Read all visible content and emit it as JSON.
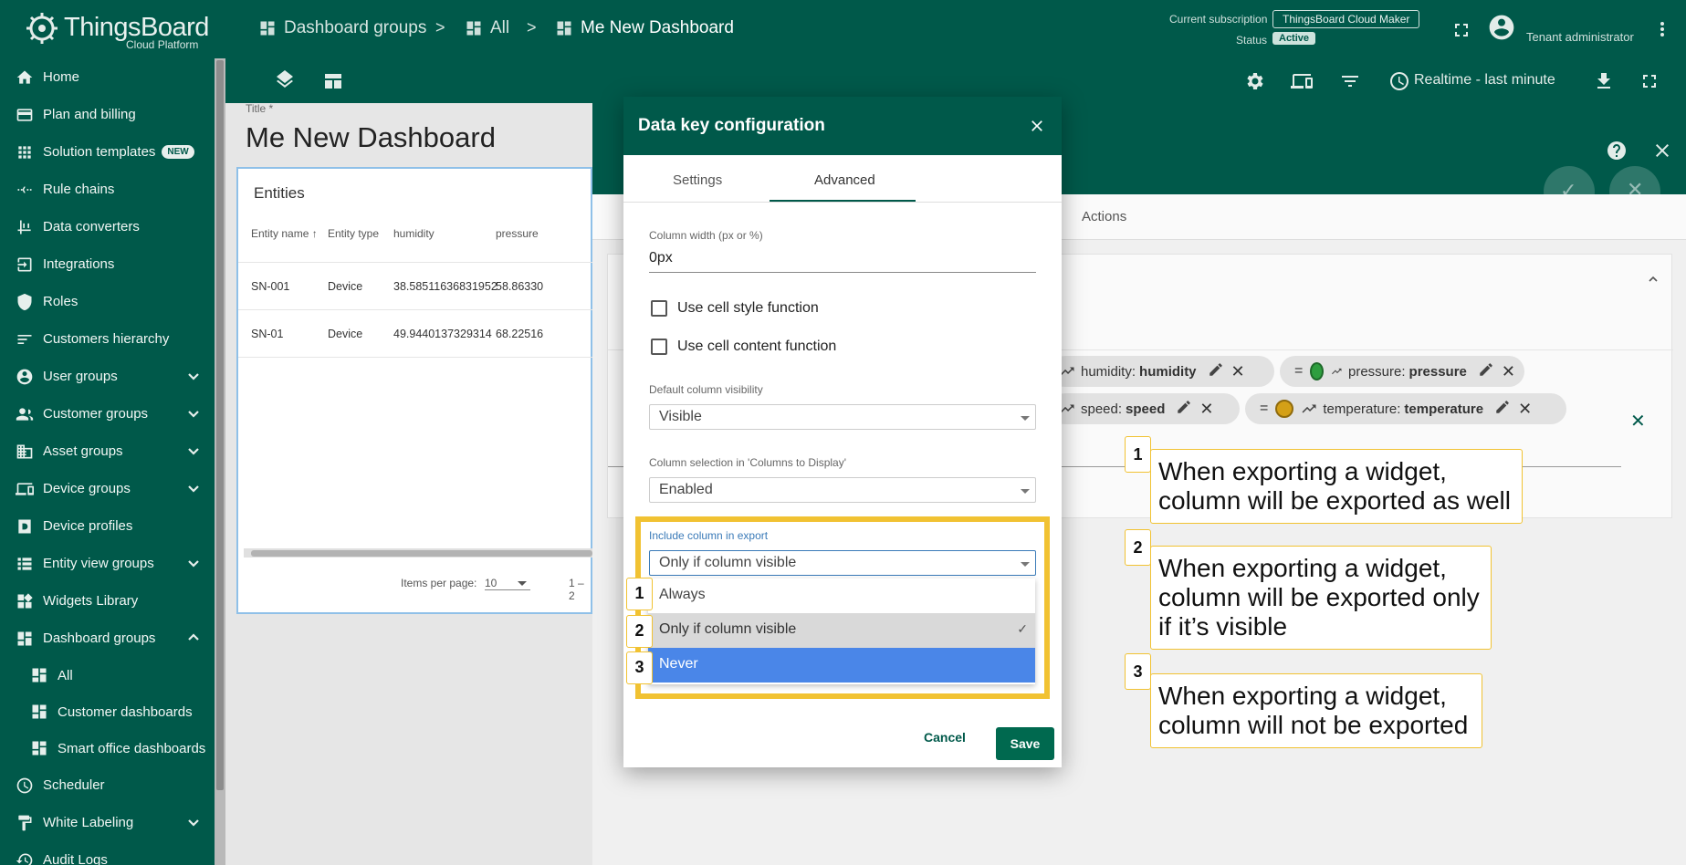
{
  "app": {
    "logo_name": "ThingsBoard",
    "logo_sub": "Cloud Platform"
  },
  "sidebar": {
    "items": [
      {
        "label": "Home",
        "icon": "home-icon"
      },
      {
        "label": "Plan and billing",
        "icon": "billing-icon"
      },
      {
        "label": "Solution templates",
        "icon": "grid-icon",
        "badge": "NEW"
      },
      {
        "label": "Rule chains",
        "icon": "rule-chain-icon"
      },
      {
        "label": "Data converters",
        "icon": "converter-icon"
      },
      {
        "label": "Integrations",
        "icon": "integration-icon"
      },
      {
        "label": "Roles",
        "icon": "shield-icon"
      },
      {
        "label": "Customers hierarchy",
        "icon": "hierarchy-icon"
      },
      {
        "label": "User groups",
        "icon": "user-icon",
        "expandable": true
      },
      {
        "label": "Customer groups",
        "icon": "people-icon",
        "expandable": true
      },
      {
        "label": "Asset groups",
        "icon": "asset-icon",
        "expandable": true
      },
      {
        "label": "Device groups",
        "icon": "device-icon",
        "expandable": true
      },
      {
        "label": "Device profiles",
        "icon": "device-profile-icon"
      },
      {
        "label": "Entity view groups",
        "icon": "entity-view-icon",
        "expandable": true
      },
      {
        "label": "Widgets Library",
        "icon": "widgets-icon"
      },
      {
        "label": "Dashboard groups",
        "icon": "dashboard-icon",
        "expanded": true
      },
      {
        "label": "All",
        "icon": "dashboard-icon",
        "sub": true
      },
      {
        "label": "Customer dashboards",
        "icon": "dashboard-icon",
        "sub": true
      },
      {
        "label": "Smart office dashboards",
        "icon": "dashboard-icon",
        "sub": true
      },
      {
        "label": "Scheduler",
        "icon": "clock-icon"
      },
      {
        "label": "White Labeling",
        "icon": "paint-roller-icon",
        "expandable": true
      },
      {
        "label": "Audit Logs",
        "icon": "audit-icon"
      }
    ]
  },
  "topbar": {
    "breadcrumb": [
      "Dashboard groups",
      "All",
      "Me New Dashboard"
    ],
    "separator": ">",
    "subscription_label": "Current subscription",
    "subscription_value": "ThingsBoard Cloud Maker",
    "status_label": "Status",
    "status_value": "Active",
    "user_role": "Tenant administrator",
    "timewindow": "Realtime - last minute"
  },
  "dashboard": {
    "title_label": "Title *",
    "title": "Me New Dashboard",
    "widget": {
      "title": "Entities",
      "columns": [
        "Entity name",
        "Entity type",
        "humidity",
        "pressure"
      ],
      "rows": [
        [
          "SN-001",
          "Device",
          "38.58511636831952",
          "58.86330"
        ],
        [
          "SN-01",
          "Device",
          "49.9440137329314",
          "68.22516"
        ]
      ],
      "items_per_page_label": "Items per page:",
      "items_per_page_value": "10",
      "range": "1 – 2"
    }
  },
  "editor": {
    "actions_tab": "Actions",
    "chips": [
      {
        "label": "humidity:",
        "key": "humidity"
      },
      {
        "label": "pressure:",
        "key": "pressure",
        "color": "#2e9e3f"
      },
      {
        "label": "speed:",
        "key": "speed"
      },
      {
        "label": "temperature:",
        "key": "temperature",
        "color": "#d4a017"
      }
    ]
  },
  "dialog": {
    "title": "Data key configuration",
    "tabs": [
      "Settings",
      "Advanced"
    ],
    "active_tab": "Advanced",
    "column_width_label": "Column width (px or %)",
    "column_width_value": "0px",
    "cell_style_label": "Use cell style function",
    "cell_content_label": "Use cell content function",
    "default_visibility_label": "Default column visibility",
    "default_visibility_value": "Visible",
    "column_selection_label": "Column selection in 'Columns to Display'",
    "column_selection_value": "Enabled",
    "include_export_label": "Include column in export",
    "include_export_value": "Only if column visible",
    "options": [
      "Always",
      "Only if column visible",
      "Never"
    ],
    "selected_check": "✓",
    "cancel": "Cancel",
    "save": "Save"
  },
  "callouts": [
    {
      "num": "1",
      "text": "When exporting a widget, column will be exported as well"
    },
    {
      "num": "2",
      "text": "When exporting a widget, column will be exported only if it’s visible"
    },
    {
      "num": "3",
      "text": "When exporting a widget, column will not be exported"
    }
  ],
  "colors": {
    "primary": "#00594a",
    "highlight": "#f1c232",
    "option_active": "#4a86e8"
  }
}
